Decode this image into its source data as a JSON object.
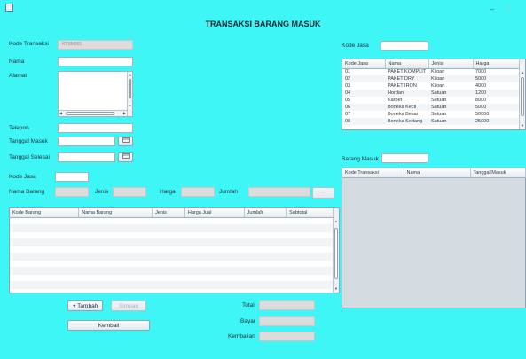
{
  "window": {
    "title": "TRANSAKSI BARANG MASUK",
    "minimize_glyph": "–",
    "maximize_glyph": "□"
  },
  "form": {
    "kode_transaksi_label": "Kode Transaksi",
    "kode_transaksi_value": "KTSM001",
    "nama_label": "Nama",
    "alamat_label": "Alamat",
    "telepon_label": "Telepon",
    "tanggal_masuk_label": "Tanggal Masuk",
    "tanggal_selesai_label": "Tanggal Selesai",
    "kode_jasa_label": "Kode Jasa",
    "nama_barang_label": "Nama Barang",
    "jenis_label": "Jenis",
    "harga_label": "Harga",
    "jumlah_label": "Jumlah",
    "dash_button": "-",
    "calendar_icon": "calendar-icon"
  },
  "detail_table": {
    "headers": [
      "Kode Barang",
      "Nama Barang",
      "Jenis",
      "Harga Jual",
      "Jumlah",
      "Subtotal"
    ]
  },
  "buttons": {
    "tambah": "+ Tambah",
    "simpan": "Simpan",
    "kembali": "Kembali"
  },
  "totals": {
    "total_label": "Total",
    "bayar_label": "Bayar",
    "kembalian_label": "Kembalian"
  },
  "jasa_panel": {
    "label": "Kode Jasa",
    "headers": [
      "Kode Jasa",
      "Nama",
      "Jenis",
      "Harga"
    ],
    "rows": [
      [
        "01",
        "PAKET KOMPLIT",
        "Kiloan",
        "7000"
      ],
      [
        "02",
        "PAKET DRY",
        "Kiloan",
        "5000"
      ],
      [
        "03",
        "PAKET IRON",
        "Kiloan",
        "4000"
      ],
      [
        "04",
        "Hordan",
        "Satuan",
        "1200"
      ],
      [
        "05",
        "Karpet",
        "Satuan",
        "8000"
      ],
      [
        "06",
        "Boneka Kecil",
        "Satuan",
        "5000"
      ],
      [
        "07",
        "Boneka Besar",
        "Satuan",
        "50000"
      ],
      [
        "08",
        "Boneka Sedang",
        "Satuan",
        "25000"
      ]
    ]
  },
  "barang_panel": {
    "label": "Barang Masuk",
    "headers": [
      "Kode Transaksi",
      "Nama",
      "Tanggal Masuk"
    ]
  }
}
